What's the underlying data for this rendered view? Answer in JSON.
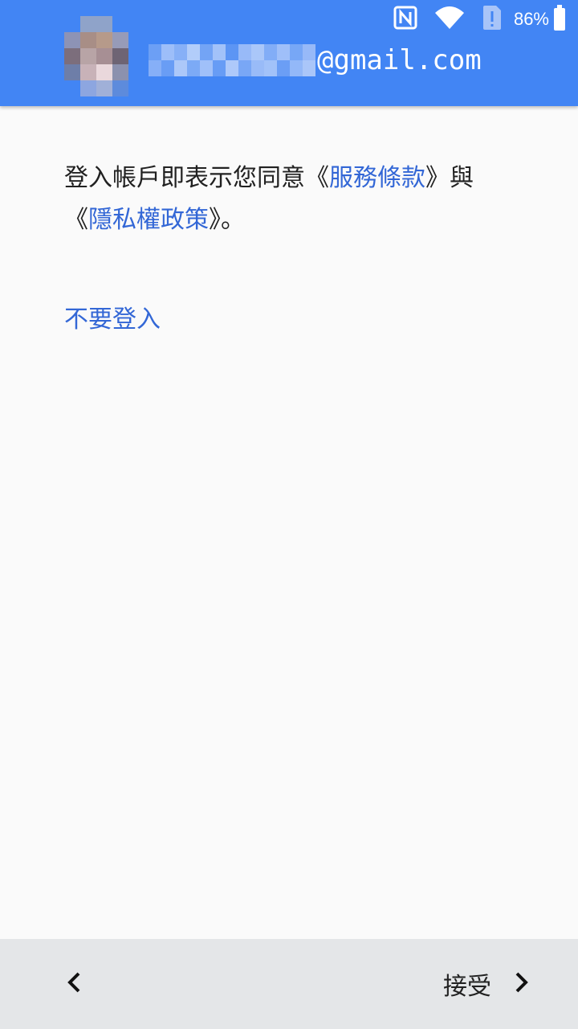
{
  "status_bar": {
    "battery_percent": "86%",
    "icons": [
      "nfc-icon",
      "wifi-icon",
      "sim-alert-icon",
      "battery-icon"
    ]
  },
  "account": {
    "email_domain": "@gmail.com"
  },
  "terms": {
    "line1_prefix": "登入帳戶即表示您同意《",
    "terms_link": "服務條款",
    "line1_suffix": "》與",
    "line2_prefix": "《",
    "privacy_link": "隱私權政策",
    "line2_suffix": "》。"
  },
  "skip_link": "不要登入",
  "footer": {
    "accept_label": "接受",
    "icons": [
      "chevron-left-icon",
      "chevron-right-icon"
    ]
  },
  "colors": {
    "header": "#4285f4",
    "link": "#3367d6",
    "background": "#fafafa",
    "footer": "#e4e6e8"
  }
}
